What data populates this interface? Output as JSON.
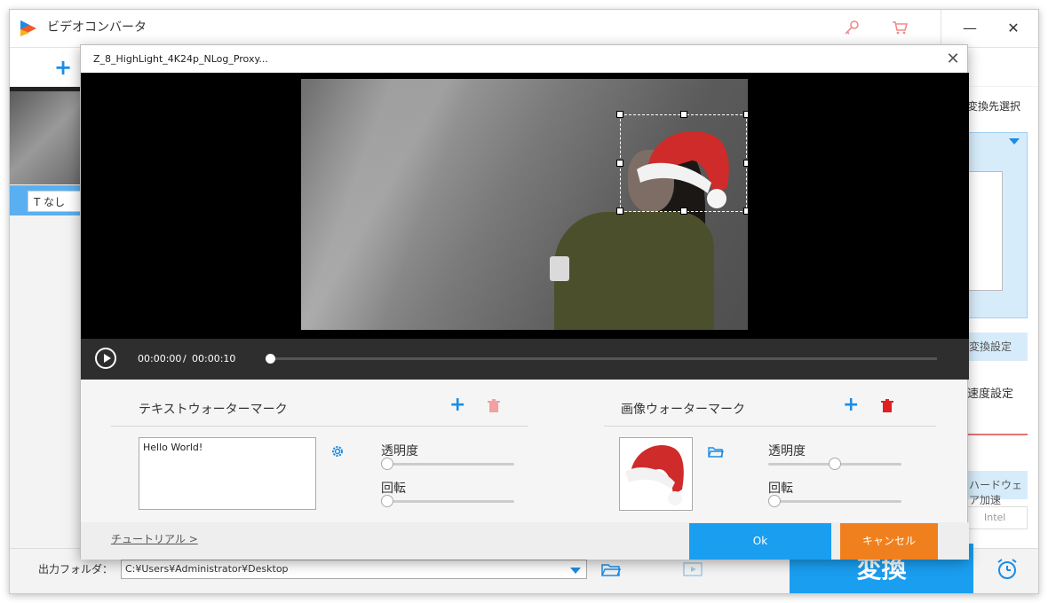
{
  "app": {
    "title": "ビデオコンバータ"
  },
  "background": {
    "none_label": "なし",
    "right": {
      "label1": "変換先選択",
      "button1": "変換設定",
      "label2": "速度設定",
      "button2": "ハードウェア加速",
      "intel": "Intel"
    },
    "output_label": "出力フォルダ：",
    "output_path": "C:¥Users¥Administrator¥Desktop",
    "convert_label": "変換"
  },
  "dialog": {
    "title": "Z_8_HighLight_4K24p_NLog_Proxy...",
    "time_current": "00:00:00",
    "time_sep": "/",
    "time_total": "00:00:10",
    "text_section": {
      "title": "テキストウォーターマーク",
      "input_value": "Hello World!",
      "opacity_label": "透明度",
      "opacity_value": 0,
      "rotation_label": "回転",
      "rotation_value": 0
    },
    "image_section": {
      "title": "画像ウォーターマーク",
      "opacity_label": "透明度",
      "opacity_value": 0.5,
      "rotation_label": "回転",
      "rotation_value": 0
    },
    "tutorial_label": "チュートリアル >",
    "ok_label": "Ok",
    "cancel_label": "キャンセル"
  },
  "colors": {
    "accent": "#1a9ef0",
    "cancel": "#f0801e",
    "trash_active": "#e02020",
    "trash_disabled": "#f2a0a0"
  }
}
